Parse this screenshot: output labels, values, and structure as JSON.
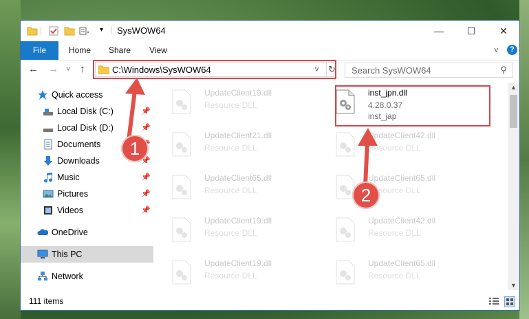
{
  "window": {
    "title": "SysWOW64",
    "minimize": "—",
    "maximize": "☐",
    "close": "✕"
  },
  "ribbon": {
    "file": "File",
    "home": "Home",
    "share": "Share",
    "view": "View",
    "expand_icon": "˅",
    "help_icon": "?"
  },
  "nav": {
    "back": "←",
    "forward": "→",
    "recent": "˅",
    "up": "↑",
    "address": "C:\\Windows\\SysWOW64",
    "dropdown": "˅",
    "refresh": "↻",
    "search_placeholder": "Search SysWOW64",
    "search_icon": "⚲"
  },
  "sidebar": {
    "items": [
      {
        "label": "Quick access",
        "icon": "star-icon"
      },
      {
        "label": "Local Disk (C:)",
        "icon": "drive-icon",
        "pinned": true
      },
      {
        "label": "Local Disk (D:)",
        "icon": "drive-icon",
        "pinned": true
      },
      {
        "label": "Documents",
        "icon": "documents-icon",
        "pinned": true
      },
      {
        "label": "Downloads",
        "icon": "downloads-icon",
        "pinned": true
      },
      {
        "label": "Music",
        "icon": "music-icon",
        "pinned": true
      },
      {
        "label": "Pictures",
        "icon": "pictures-icon",
        "pinned": true
      },
      {
        "label": "Videos",
        "icon": "videos-icon",
        "pinned": true
      },
      {
        "label": "OneDrive",
        "icon": "onedrive-icon"
      },
      {
        "label": "This PC",
        "icon": "pc-icon",
        "selected": true
      },
      {
        "label": "Network",
        "icon": "network-icon"
      }
    ],
    "pin_glyph": "📌"
  },
  "files": {
    "left": [
      {
        "name": "UpdateClient19.dll",
        "type": "Resource DLL"
      },
      {
        "name": "UpdateClient21.dll",
        "type": "Resource DLL"
      },
      {
        "name": "UpdateClient65.dll",
        "type": "Resource DLL"
      },
      {
        "name": "UpdateClient19.dll",
        "type": "Resource DLL"
      },
      {
        "name": "UpdateClient19.dll",
        "type": "Resource DLL"
      }
    ],
    "right": [
      {
        "name": "UpdateClient42.dll",
        "type": "Resource DLL"
      },
      {
        "name": "UpdateClient65.dll",
        "type": "Resource DLL"
      },
      {
        "name": "UpdateClient42.dll",
        "type": "Resource DLL"
      },
      {
        "name": "UpdateClient65.dll",
        "type": "Resource DLL"
      }
    ],
    "highlighted": {
      "name": "inst_jpn.dll",
      "version": "4.28.0.37",
      "type": "inst_jap"
    }
  },
  "status": {
    "count": "111 items"
  },
  "annotations": {
    "one": "1",
    "two": "2",
    "color": "#e14f49"
  }
}
